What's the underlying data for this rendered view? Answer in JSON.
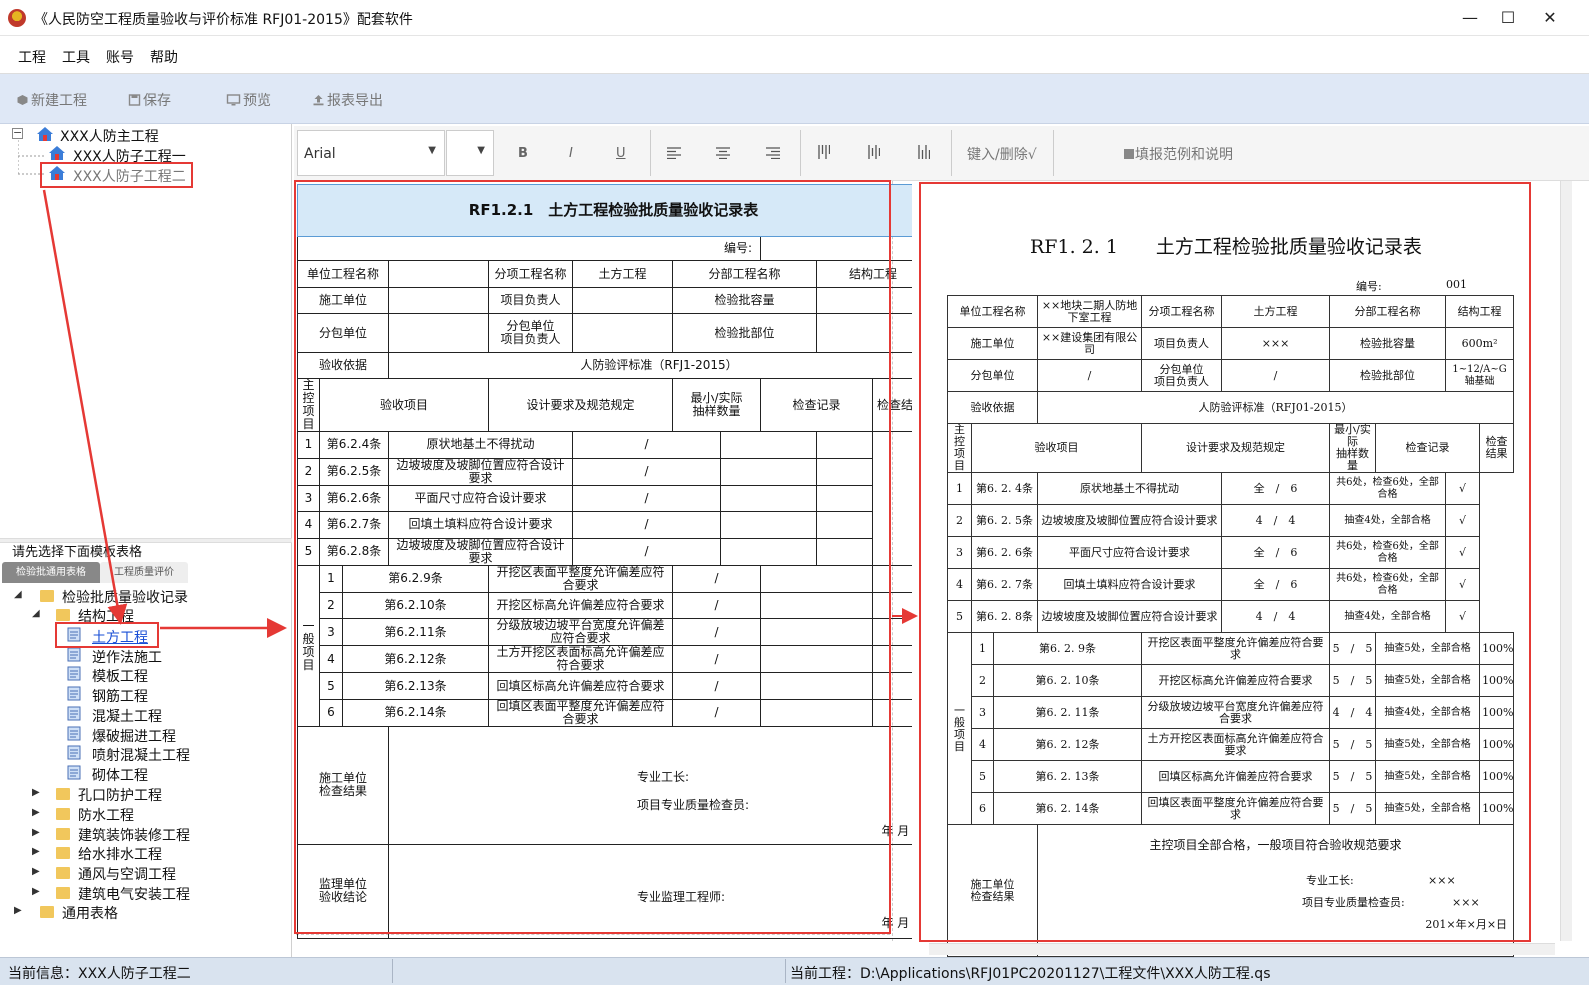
{
  "window": {
    "title": "《人民防空工程质量验收与评价标准 RFJ01-2015》配套软件"
  },
  "menu": [
    "工程",
    "工具",
    "账号",
    "帮助"
  ],
  "toolbar": {
    "new": "新建工程",
    "save": "保存",
    "preview": "预览",
    "export": "报表导出"
  },
  "project_tree": {
    "root": "XXX人防主工程",
    "children": [
      "XXX人防子工程一",
      "XXX人防子工程二"
    ]
  },
  "template_panel": {
    "hint": "请先选择下面模板表格",
    "tabs": [
      "检验批通用表格",
      "工程质量评价"
    ],
    "group": "检验批质量验收记录",
    "sub_group": "结构工程",
    "items": [
      "土方工程",
      "逆作法施工",
      "模板工程",
      "钢筋工程",
      "混凝土工程",
      "爆破掘进工程",
      "喷射混凝土工程",
      "砌体工程"
    ],
    "other_groups": [
      "孔口防护工程",
      "防水工程",
      "建筑装饰装修工程",
      "给水排水工程",
      "通风与空调工程",
      "建筑电气安装工程"
    ],
    "last": "通用表格"
  },
  "format_bar": {
    "font": "Arial",
    "bold": "B",
    "italic": "I",
    "underline": "U",
    "insert_delete": "键入/删除√",
    "help": "填报范例和说明"
  },
  "form": {
    "title": "RF1.2.1　土方工程检验批质量验收记录表",
    "title_preview": "RF1. 2. 1　　土方工程检验批质量验收记录表",
    "code_label": "编号:",
    "code_label_preview": "编号:",
    "code_value": "001",
    "unit_project": "单位工程名称",
    "sub_item": "分项工程名称",
    "sub_item_value": "土方工程",
    "sub_part": "分部工程名称",
    "sub_part_value": "结构工程",
    "builder": "施工单位",
    "project_lead": "项目负责人",
    "batch_capacity": "检验批容量",
    "subcontractor": "分包单位",
    "sub_lead_1": "分包单位",
    "sub_lead_2": "项目负责人",
    "batch_part": "检验批部位",
    "basis": "验收依据",
    "basis_value": "人防验评标准（RFJ1-2015）",
    "basis_value_preview": "人防验评标准（RFJ01-2015）",
    "col_item": "验收项目",
    "col_design": "设计要求及规范规定",
    "col_min_1": "最小/实际",
    "col_min_2": "抽样数量",
    "col_record": "检查记录",
    "col_result": "检查结果",
    "main_label": [
      "主",
      "控",
      "项",
      "目"
    ],
    "general_label": [
      "一",
      "般",
      "项",
      "目"
    ],
    "main_items": [
      {
        "no": "1",
        "clause": "第6.2.4条",
        "desc": "原状地基土不得扰动"
      },
      {
        "no": "2",
        "clause": "第6.2.5条",
        "desc": "边坡坡度及坡脚位置应符合设计要求"
      },
      {
        "no": "3",
        "clause": "第6.2.6条",
        "desc": "平面尺寸应符合设计要求"
      },
      {
        "no": "4",
        "clause": "第6.2.7条",
        "desc": "回填土填料应符合设计要求"
      },
      {
        "no": "5",
        "clause": "第6.2.8条",
        "desc": "边坡坡度及坡脚位置应符合设计要求"
      }
    ],
    "general_items": [
      {
        "no": "1",
        "clause": "第6.2.9条",
        "desc": "开挖区表面平整度允许偏差应符合要求"
      },
      {
        "no": "2",
        "clause": "第6.2.10条",
        "desc": "开挖区标高允许偏差应符合要求"
      },
      {
        "no": "3",
        "clause": "第6.2.11条",
        "desc": "分级放坡边坡平台宽度允许偏差应符合要求"
      },
      {
        "no": "4",
        "clause": "第6.2.12条",
        "desc": "土方开挖区表面标高允许偏差应符合要求"
      },
      {
        "no": "5",
        "clause": "第6.2.13条",
        "desc": "回填区标高允许偏差应符合要求"
      },
      {
        "no": "6",
        "clause": "第6.2.14条",
        "desc": "回填区表面平整度允许偏差应符合要求"
      }
    ],
    "slash": "/",
    "builder_check_1": "施工单位",
    "builder_check_2": "检查结果",
    "foreman": "专业工长:",
    "inspector": "项目专业质量检查员:",
    "date": "年 月 日",
    "supervisor_1": "监理单位",
    "supervisor_2": "验收结论",
    "supervising_engineer": "专业监理工程师:"
  },
  "preview": {
    "unit_project_value": "××地块二期人防地下室工程",
    "builder_value": "××建设集团有限公司",
    "project_lead_value": "×××",
    "batch_capacity_value": "600m²",
    "subcontractor_value": "/",
    "sub_lead_value": "/",
    "batch_part_value": "1~12/A~G轴基础",
    "main_items": [
      {
        "no": "1",
        "clause": "第6. 2. 4条",
        "desc": "原状地基土不得扰动",
        "sample": "全　/　6",
        "record": "共6处，检查6处，全部合格",
        "result": "√"
      },
      {
        "no": "2",
        "clause": "第6. 2. 5条",
        "desc": "边坡坡度及坡脚位置应符合设计要求",
        "sample": "4　/　4",
        "record": "抽查4处，全部合格",
        "result": "√"
      },
      {
        "no": "3",
        "clause": "第6. 2. 6条",
        "desc": "平面尺寸应符合设计要求",
        "sample": "全　/　6",
        "record": "共6处，检查6处，全部合格",
        "result": "√"
      },
      {
        "no": "4",
        "clause": "第6. 2. 7条",
        "desc": "回填土填料应符合设计要求",
        "sample": "全　/　6",
        "record": "共6处，检查6处，全部合格",
        "result": "√"
      },
      {
        "no": "5",
        "clause": "第6. 2. 8条",
        "desc": "边坡坡度及坡脚位置应符合设计要求",
        "sample": "4　/　4",
        "record": "抽查4处，全部合格",
        "result": "√"
      }
    ],
    "general_items": [
      {
        "no": "1",
        "clause": "第6. 2. 9条",
        "desc": "开挖区表面平整度允许偏差应符合要求",
        "sample": "5　/　5",
        "record": "抽查5处，全部合格",
        "result": "100%"
      },
      {
        "no": "2",
        "clause": "第6. 2. 10条",
        "desc": "开挖区标高允许偏差应符合要求",
        "sample": "5　/　5",
        "record": "抽查5处，全部合格",
        "result": "100%"
      },
      {
        "no": "3",
        "clause": "第6. 2. 11条",
        "desc": "分级放坡边坡平台宽度允许偏差应符合要求",
        "sample": "4　/　4",
        "record": "抽查4处，全部合格",
        "result": "100%"
      },
      {
        "no": "4",
        "clause": "第6. 2. 12条",
        "desc": "土方开挖区表面标高允许偏差应符合要求",
        "sample": "5　/　5",
        "record": "抽查5处，全部合格",
        "result": "100%"
      },
      {
        "no": "5",
        "clause": "第6. 2. 13条",
        "desc": "回填区标高允许偏差应符合要求",
        "sample": "5　/　5",
        "record": "抽查5处，全部合格",
        "result": "100%"
      },
      {
        "no": "6",
        "clause": "第6. 2. 14条",
        "desc": "回填区表面平整度允许偏差应符合要求",
        "sample": "5　/　5",
        "record": "抽查5处，全部合格",
        "result": "100%"
      }
    ],
    "conclusion": "主控项目全部合格，一般项目符合验收规范要求",
    "foreman_value": "×××",
    "inspector_value": "×××",
    "date_value": "201×年×月×日"
  },
  "status": {
    "current_info": "当前信息：XXX人防子工程二",
    "current_project": "当前工程：D:\\Applications\\RFJ01PC20201127\\工程文件\\XXX人防工程.qs"
  }
}
